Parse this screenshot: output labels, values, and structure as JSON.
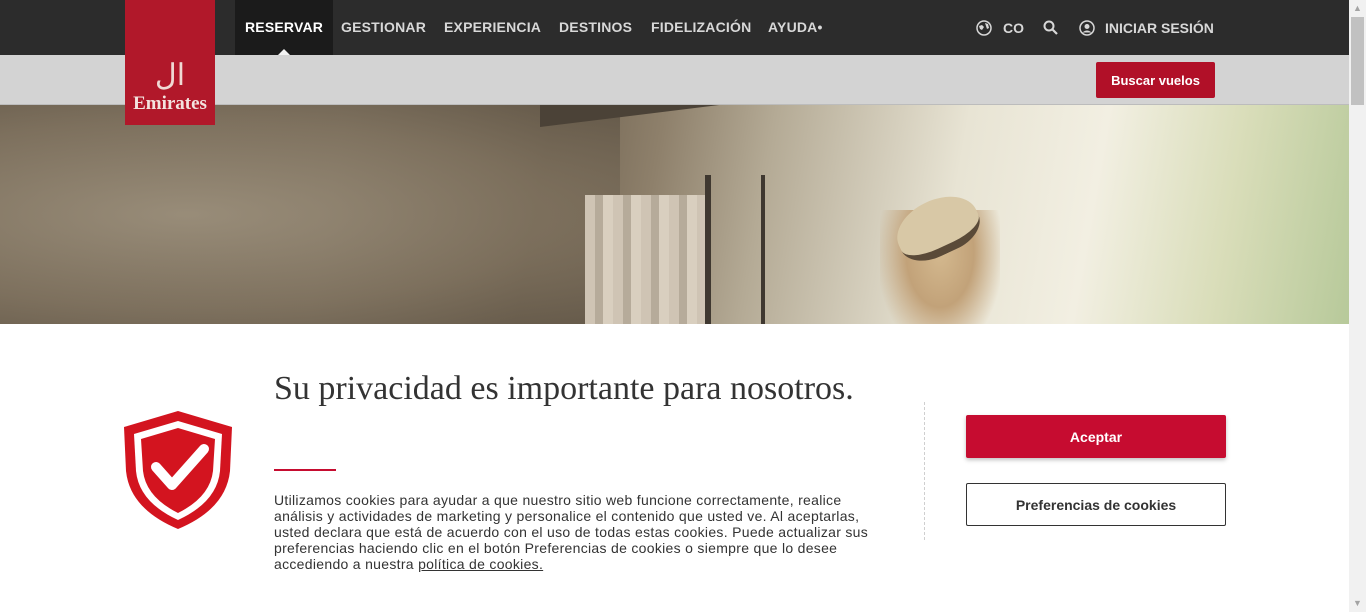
{
  "nav": {
    "items": [
      {
        "label": "RESERVAR"
      },
      {
        "label": "GESTIONAR"
      },
      {
        "label": "EXPERIENCIA"
      },
      {
        "label": "DESTINOS"
      },
      {
        "label": "FIDELIZACIÓN"
      },
      {
        "label": "AYUDA•"
      }
    ],
    "country": "CO",
    "login": "INICIAR SESIÓN"
  },
  "logo": {
    "text": "Emirates"
  },
  "subbar": {
    "search_flights": "Buscar vuelos"
  },
  "cookie": {
    "title": "Su privacidad es importante para nosotros.",
    "body": "Utilizamos cookies para ayudar a que nuestro sitio web funcione correctamente, realice análisis y actividades de marketing y personalice el contenido que usted ve. Al aceptarlas, usted declara que está de acuerdo con el uso de todas estas cookies. Puede actualizar sus preferencias haciendo clic en el botón Preferencias de cookies o siempre que lo desee accediendo a nuestra ",
    "link": "política de cookies.",
    "accept": "Aceptar",
    "preferences": "Preferencias de cookies"
  },
  "colors": {
    "brand_red": "#c60c30",
    "nav_bg": "#2c2c2c"
  }
}
